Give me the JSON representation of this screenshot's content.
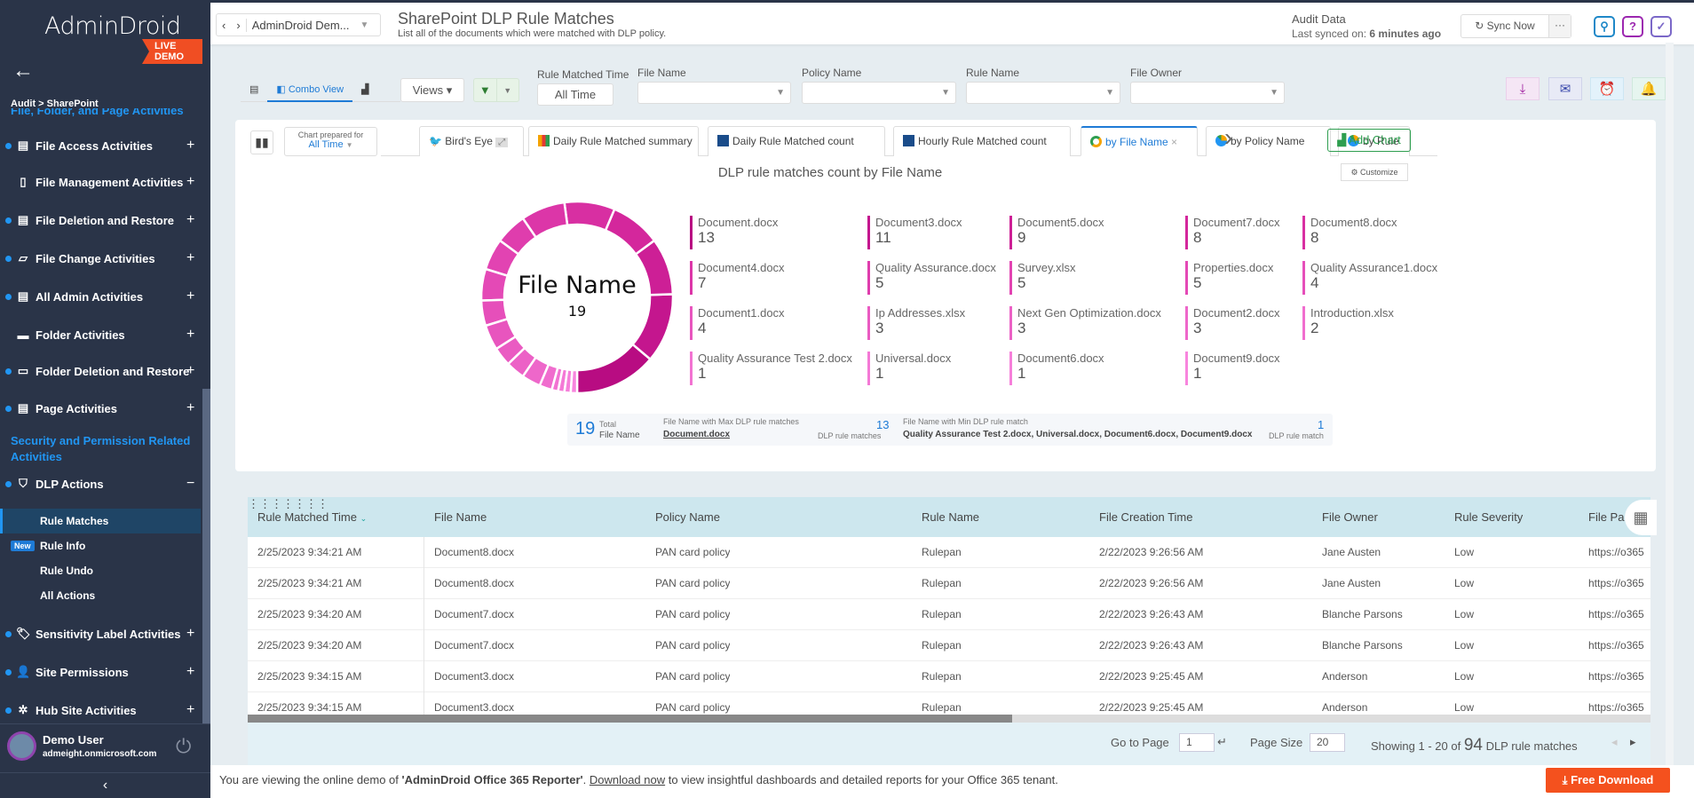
{
  "sidebar": {
    "logo": "AdminDroid",
    "badge": "LIVE DEMO",
    "breadcrumb": "Audit > SharePoint",
    "cut_heading": "File, Folder, and Page Activities",
    "items": [
      {
        "label": "File Access Activities",
        "icon": "file-access-icon",
        "dot": true
      },
      {
        "label": "File Management Activities",
        "icon": "file-gear-icon",
        "dot": false
      },
      {
        "label": "File Deletion and Restore",
        "icon": "file-delete-icon",
        "dot": true
      },
      {
        "label": "File Change Activities",
        "icon": "file-edit-icon",
        "dot": true
      },
      {
        "label": "All Admin Activities",
        "icon": "admin-file-icon",
        "dot": true
      },
      {
        "label": "Folder Activities",
        "icon": "folder-icon",
        "dot": false
      },
      {
        "label": "Folder Deletion and Restore",
        "icon": "folder-delete-icon",
        "dot": true
      },
      {
        "label": "Page Activities",
        "icon": "page-icon",
        "dot": true
      }
    ],
    "section_heading": "Security and Permission Related Activities",
    "dlp": {
      "label": "DLP Actions",
      "toggle": "−"
    },
    "subitems": [
      {
        "label": "Rule Matches",
        "active": true
      },
      {
        "label": "Rule Info",
        "badge": "New"
      },
      {
        "label": "Rule Undo"
      },
      {
        "label": "All Actions"
      }
    ],
    "items2": [
      {
        "label": "Sensitivity Label Activities"
      },
      {
        "label": "Site Permissions"
      },
      {
        "label": "Hub Site Activities"
      }
    ],
    "expand": "+",
    "user": {
      "name": "Demo User",
      "email": "admeight.onmicrosoft.com"
    }
  },
  "topbar": {
    "tenant": "AdminDroid Dem...",
    "title": "SharePoint DLP Rule Matches",
    "subtitle": "List all of the documents which were matched with DLP policy.",
    "audit_label": "Audit Data",
    "sync_prefix": "Last synced on: ",
    "sync_time": "6 minutes ago",
    "sync_button": "Sync Now",
    "more": "···"
  },
  "toolbar": {
    "view_tab": "Combo View",
    "views": "Views",
    "filters": [
      {
        "label": "Rule Matched Time",
        "value": "All Time"
      },
      {
        "label": "File Name",
        "value": ""
      },
      {
        "label": "Policy Name",
        "value": ""
      },
      {
        "label": "Rule Name",
        "value": ""
      },
      {
        "label": "File Owner",
        "value": ""
      }
    ]
  },
  "chart_panel": {
    "prepared_label": "Chart prepared for",
    "prepared_value": "All Time",
    "tabs": [
      "Bird's Eye",
      "Daily Rule Matched summary",
      "Daily Rule Matched count",
      "Hourly Rule Matched count",
      "by File Name",
      "by Policy Name",
      "by Rule"
    ],
    "add_chart": "Add Chart",
    "customize": "Customize",
    "summary": {
      "total": "19",
      "total_l1": "Total",
      "total_l2": "File Name",
      "max_label": "File Name with Max DLP rule matches",
      "max_file": "Document.docx",
      "max_val": "13",
      "max_unit": "DLP rule matches",
      "min_label": "File Name with Min DLP rule match",
      "min_files": "Quality Assurance Test 2.docx, Universal.docx, Document6.docx, Document9.docx",
      "min_val": "1",
      "min_unit": "DLP rule match"
    }
  },
  "chart_data": {
    "type": "pie",
    "title": "DLP rule matches count by File Name",
    "center_label": "File Name",
    "center_value": "19",
    "categories": [
      "Document.docx",
      "Document3.docx",
      "Document5.docx",
      "Document7.docx",
      "Document8.docx",
      "Document4.docx",
      "Quality Assurance.docx",
      "Survey.xlsx",
      "Properties.docx",
      "Quality Assurance1.docx",
      "Document1.docx",
      "Ip Addresses.xlsx",
      "Next Gen Optimization.docx",
      "Document2.docx",
      "Introduction.xlsx",
      "Quality Assurance Test 2.docx",
      "Universal.docx",
      "Document6.docx",
      "Document9.docx"
    ],
    "values": [
      13,
      11,
      9,
      8,
      8,
      7,
      5,
      5,
      5,
      4,
      4,
      3,
      3,
      3,
      2,
      1,
      1,
      1,
      1
    ],
    "colors": [
      "#b80c82",
      "#c4168e",
      "#cd1f96",
      "#d4279c",
      "#d82fa2",
      "#dc36a8",
      "#df3dad",
      "#e243b2",
      "#e449b6",
      "#e64fba",
      "#e855be",
      "#ea5bc2",
      "#ec61c6",
      "#ee67ca",
      "#f06dce",
      "#f273d2",
      "#f479d6",
      "#f67fda",
      "#f885de"
    ],
    "legend": "right"
  },
  "table": {
    "columns": [
      "Rule Matched Time",
      "File Name",
      "Policy Name",
      "Rule Name",
      "File Creation Time",
      "File Owner",
      "Rule Severity",
      "File Pa"
    ],
    "rows": [
      [
        "2/25/2023 9:34:21 AM",
        "Document8.docx",
        "PAN card policy",
        "Rulepan",
        "2/22/2023 9:26:56 AM",
        "Jane Austen",
        "Low",
        "https://o365"
      ],
      [
        "2/25/2023 9:34:21 AM",
        "Document8.docx",
        "PAN card policy",
        "Rulepan",
        "2/22/2023 9:26:56 AM",
        "Jane Austen",
        "Low",
        "https://o365"
      ],
      [
        "2/25/2023 9:34:20 AM",
        "Document7.docx",
        "PAN card policy",
        "Rulepan",
        "2/22/2023 9:26:43 AM",
        "Blanche Parsons",
        "Low",
        "https://o365"
      ],
      [
        "2/25/2023 9:34:20 AM",
        "Document7.docx",
        "PAN card policy",
        "Rulepan",
        "2/22/2023 9:26:43 AM",
        "Blanche Parsons",
        "Low",
        "https://o365"
      ],
      [
        "2/25/2023 9:34:15 AM",
        "Document3.docx",
        "PAN card policy",
        "Rulepan",
        "2/22/2023 9:25:45 AM",
        "Anderson",
        "Low",
        "https://o365"
      ],
      [
        "2/25/2023 9:34:15 AM",
        "Document3.docx",
        "PAN card policy",
        "Rulepan",
        "2/22/2023 9:25:45 AM",
        "Anderson",
        "Low",
        "https://o365"
      ]
    ]
  },
  "pager": {
    "goto_label": "Go to Page",
    "page": "1",
    "size_label": "Page Size",
    "size": "20",
    "showing": "Showing ",
    "range": "1 - 20",
    "of": " of ",
    "total": "94",
    "suffix": " DLP rule matches"
  },
  "banner": {
    "pre": "You are viewing the online demo of ",
    "product": "'AdminDroid Office 365 Reporter'",
    "mid": ". ",
    "link": "Download now",
    "post": " to view insightful dashboards and detailed reports for your Office 365 tenant.",
    "cta": "Free Download"
  }
}
